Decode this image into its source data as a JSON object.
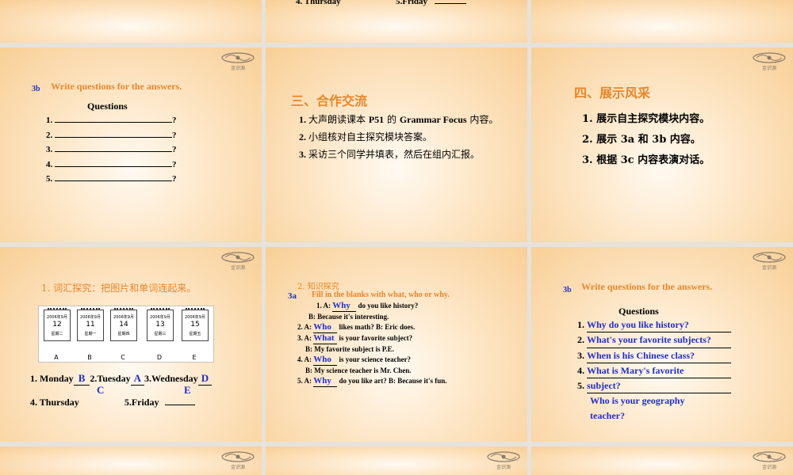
{
  "logo_text": "金识源",
  "slide_r0c1": {
    "line_a": "4. Thursday",
    "line_b": "5.Friday"
  },
  "slide_r1c0": {
    "tag": "3b",
    "title": "Write questions for the answers.",
    "subtitle": "Questions",
    "items": [
      "1.",
      "2.",
      "3.",
      "4.",
      "5."
    ],
    "q_mark": "?"
  },
  "slide_r1c1": {
    "heading": "三、合作交流",
    "items": [
      {
        "num": "1.",
        "pre": "大声朗读课本 ",
        "bold": "P51",
        "mid": " 的 ",
        "bold2": "Grammar Focus",
        "post": " 内容。"
      },
      {
        "num": "2.",
        "text": "小组核对自主探究模块答案。"
      },
      {
        "num": "3.",
        "text": "采访三个同学并填表，然后在组内汇报。"
      }
    ]
  },
  "slide_r1c2": {
    "heading": "四、展示风采",
    "items": [
      "1.  展示自主探究模块内容。",
      "2.  展示 3a 和 3b 内容。",
      "3.  根据 3c 内容表演对话。"
    ]
  },
  "slide_r2c0": {
    "title": "1.  词汇探究：把图片和单词连起来。",
    "calendars": [
      {
        "year": "2006年9月",
        "num": "12",
        "week": "星期二",
        "letter": "A"
      },
      {
        "year": "2006年9月",
        "num": "11",
        "week": "星期一",
        "letter": "B"
      },
      {
        "year": "2006年9月",
        "num": "14",
        "week": "星期四",
        "letter": "C"
      },
      {
        "year": "2006年9月",
        "num": "13",
        "week": "星期三",
        "letter": "D"
      },
      {
        "year": "2006年9月",
        "num": "15",
        "week": "星期五",
        "letter": "E"
      }
    ],
    "line1": {
      "a": "1. Monday",
      "a_ans": "B",
      "b": "2.Tuesday",
      "b_ans": "A",
      "c": "3.Wednesday",
      "c_ans": "D"
    },
    "line1_under": {
      "b_ans": "C",
      "c_ans": "E"
    },
    "line2": {
      "a": "4. Thursday",
      "b": "5.Friday"
    }
  },
  "slide_r2c1": {
    "section": "2.  知识探究",
    "tag": "3a",
    "instruction": "Fill in the blanks with what, who or why.",
    "lines": [
      {
        "pre": "1. A: ",
        "ans": "Why",
        "post": " do you like history?"
      },
      {
        "pre": "B: Because it's interesting.",
        "ans": "",
        "post": ""
      },
      {
        "pre": "2. A: ",
        "ans": "Who",
        "post": " likes math?  B: Eric does."
      },
      {
        "pre": "3. A: ",
        "ans": "What",
        "post": " is your favorite subject?"
      },
      {
        "pre": "B: My favorite subject is P.E.",
        "ans": "",
        "post": ""
      },
      {
        "pre": "4. A: ",
        "ans": "Who",
        "post": " is your science teacher?"
      },
      {
        "pre": "B: My science teacher is Mr. Chen.",
        "ans": "",
        "post": ""
      },
      {
        "pre": "5. A: ",
        "ans": "Why",
        "post": "  do you like art?  B: Because it's fun."
      }
    ]
  },
  "slide_r2c2": {
    "tag": "3b",
    "title": "Write questions for the answers.",
    "subtitle": "Questions",
    "items": [
      {
        "num": "1.",
        "ans": "Why do you like history?"
      },
      {
        "num": "2.",
        "ans": "What's your favorite subjects?"
      },
      {
        "num": "3.",
        "ans": "When is his Chinese class?"
      },
      {
        "num": "4.",
        "ans": "What is Mary's favorite"
      },
      {
        "num": "5.",
        "ans": "subject?"
      }
    ],
    "extra": [
      "Who is your geography",
      "teacher?"
    ]
  }
}
